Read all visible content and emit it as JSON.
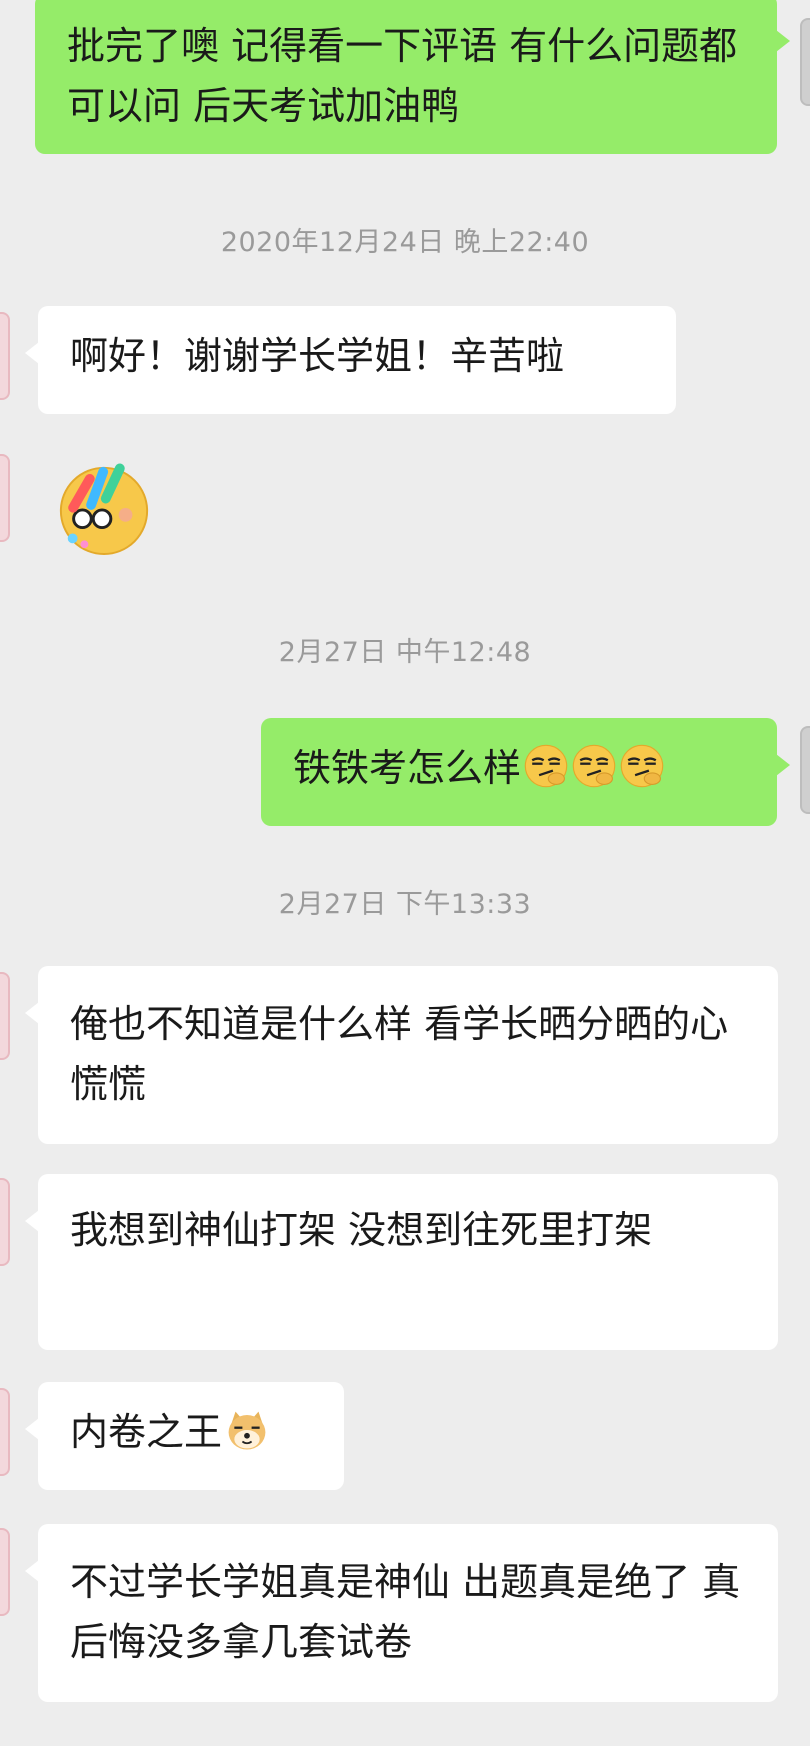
{
  "messages": [
    {
      "type": "outgoing",
      "text": "批完了噢 记得看一下评语 有什么问题都可以问 后天考试加油鸭"
    },
    {
      "type": "timestamp",
      "text": "2020年12月24日 晚上22:40"
    },
    {
      "type": "incoming",
      "text": "啊好！谢谢学长学姐！辛苦啦"
    },
    {
      "type": "incoming-sticker",
      "icon": "dizzy-face-sticker-icon"
    },
    {
      "type": "timestamp",
      "text": "2月27日 中午12:48"
    },
    {
      "type": "outgoing",
      "text": "铁铁考怎么样",
      "emojis": [
        "smirk-emoji-icon",
        "smirk-emoji-icon",
        "smirk-emoji-icon"
      ]
    },
    {
      "type": "timestamp",
      "text": "2月27日 下午13:33"
    },
    {
      "type": "incoming",
      "text": "俺也不知道是什么样 看学长晒分晒的心慌慌"
    },
    {
      "type": "incoming",
      "text": "我想到神仙打架 没想到往死里打架"
    },
    {
      "type": "incoming",
      "text": "内卷之王",
      "emojis": [
        "doge-emoji-icon"
      ]
    },
    {
      "type": "incoming",
      "text": "不过学长学姐真是神仙 出题真是绝了 真后悔没多拿几套试卷"
    }
  ],
  "colors": {
    "background": "#ededed",
    "outgoing_bubble": "#95ec69",
    "incoming_bubble": "#ffffff",
    "timestamp_text": "#9a9a9a"
  }
}
